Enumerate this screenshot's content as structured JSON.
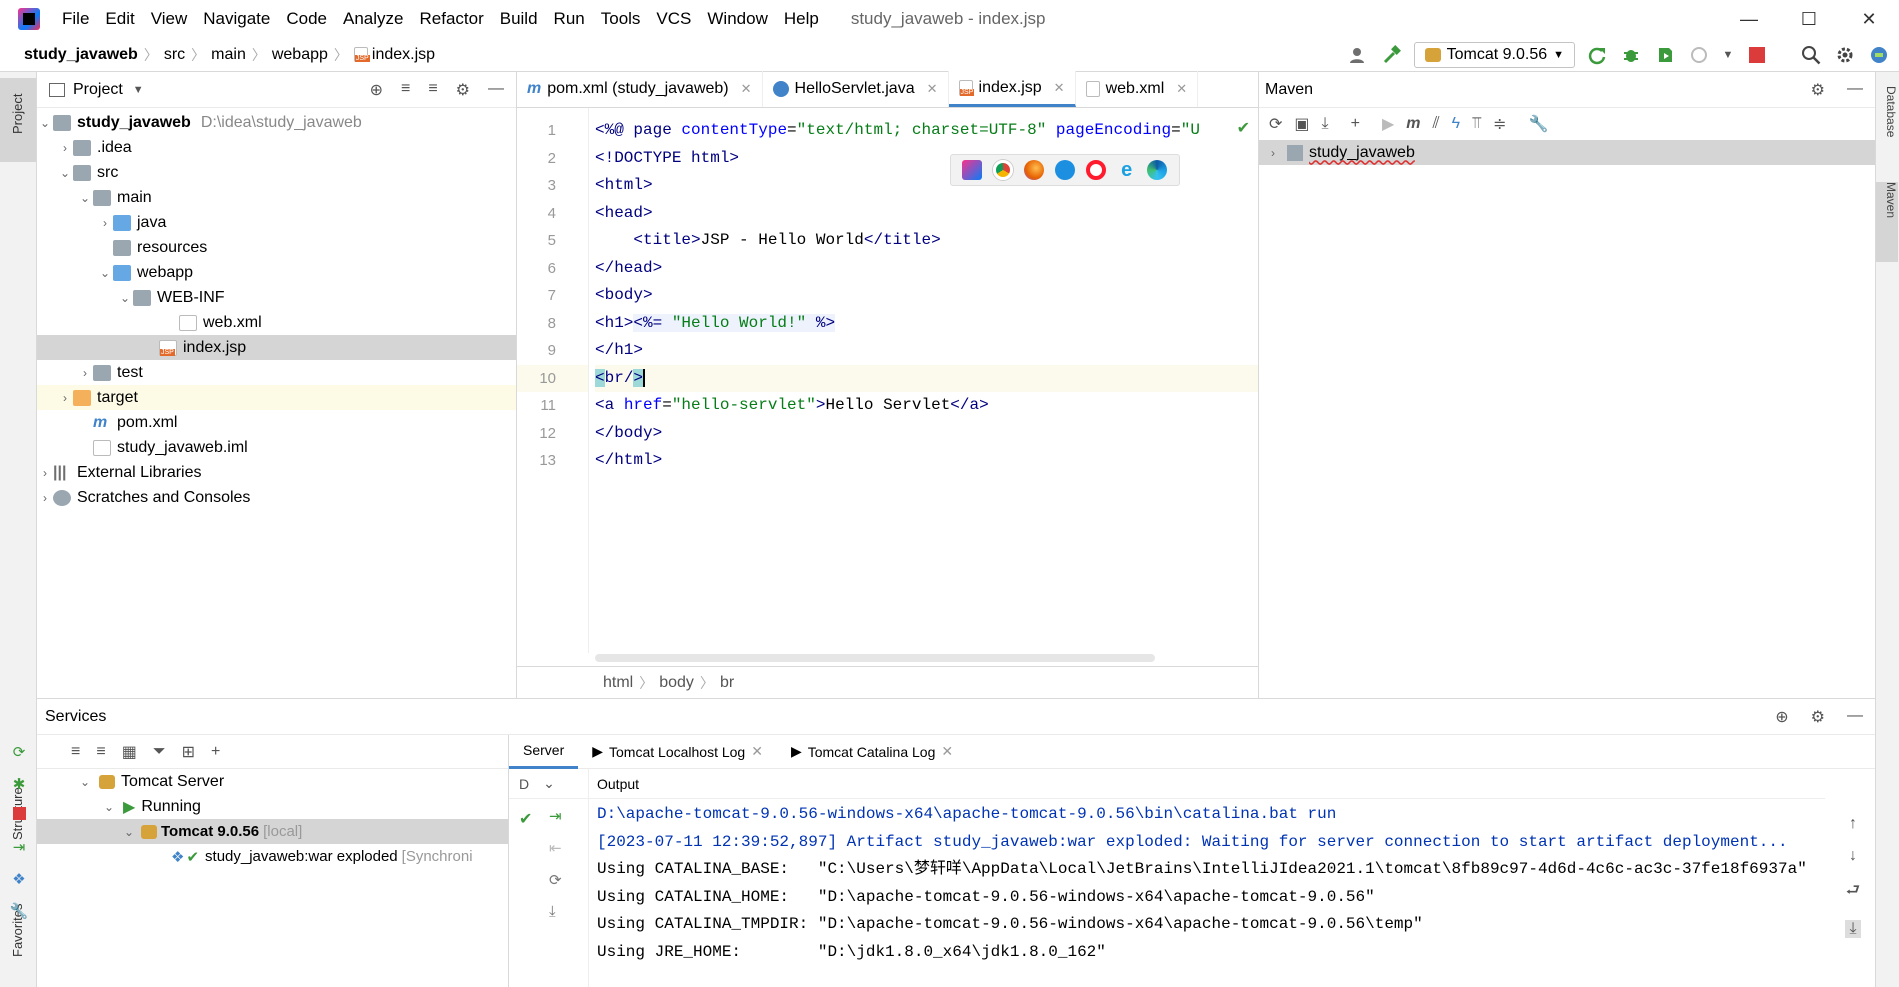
{
  "menu": [
    "File",
    "Edit",
    "View",
    "Navigate",
    "Code",
    "Analyze",
    "Refactor",
    "Build",
    "Run",
    "Tools",
    "VCS",
    "Window",
    "Help"
  ],
  "window_title": "study_javaweb - index.jsp",
  "breadcrumb": [
    "study_javaweb",
    "src",
    "main",
    "webapp",
    "index.jsp"
  ],
  "run_config": "Tomcat 9.0.56",
  "project_panel": {
    "title": "Project",
    "tree": [
      {
        "label": "study_javaweb",
        "path": "D:\\idea\\study_javaweb"
      },
      {
        "label": ".idea"
      },
      {
        "label": "src"
      },
      {
        "label": "main"
      },
      {
        "label": "java"
      },
      {
        "label": "resources"
      },
      {
        "label": "webapp"
      },
      {
        "label": "WEB-INF"
      },
      {
        "label": "web.xml"
      },
      {
        "label": "index.jsp"
      },
      {
        "label": "test"
      },
      {
        "label": "target"
      },
      {
        "label": "pom.xml"
      },
      {
        "label": "study_javaweb.iml"
      },
      {
        "label": "External Libraries"
      },
      {
        "label": "Scratches and Consoles"
      }
    ]
  },
  "editor": {
    "tabs": [
      "pom.xml (study_javaweb)",
      "HelloServlet.java",
      "index.jsp",
      "web.xml"
    ],
    "active_tab": "index.jsp",
    "line_numbers": [
      "1",
      "2",
      "3",
      "4",
      "5",
      "6",
      "7",
      "8",
      "9",
      "10",
      "11",
      "12",
      "13"
    ],
    "breadcrumb": [
      "html",
      "body",
      "br"
    ]
  },
  "maven": {
    "title": "Maven",
    "project": "study_javaweb"
  },
  "services": {
    "title": "Services",
    "tree": {
      "server": "Tomcat Server",
      "state": "Running",
      "instance": "Tomcat 9.0.56",
      "instance_tag": "[local]",
      "artifact": "study_javaweb:war exploded",
      "artifact_status": "[Synchroni"
    },
    "tabs": [
      "Server",
      "Tomcat Localhost Log",
      "Tomcat Catalina Log"
    ],
    "output_label": "Output",
    "output_lines": [
      "D:\\apache-tomcat-9.0.56-windows-x64\\apache-tomcat-9.0.56\\bin\\catalina.bat run",
      "[2023-07-11 12:39:52,897] Artifact study_javaweb:war exploded: Waiting for server connection to start artifact deployment...",
      "Using CATALINA_BASE:   \"C:\\Users\\梦轩咩\\AppData\\Local\\JetBrains\\IntelliJIdea2021.1\\tomcat\\8fb89c97-4d6d-4c6c-ac3c-37fe18f6937a\"",
      "Using CATALINA_HOME:   \"D:\\apache-tomcat-9.0.56-windows-x64\\apache-tomcat-9.0.56\"",
      "Using CATALINA_TMPDIR: \"D:\\apache-tomcat-9.0.56-windows-x64\\apache-tomcat-9.0.56\\temp\"",
      "Using JRE_HOME:        \"D:\\jdk1.8.0_x64\\jdk1.8.0_162\""
    ]
  },
  "side_tabs": {
    "left_top": "Project",
    "left_structure": "Structure",
    "left_favorites": "Favorites",
    "right_database": "Database",
    "right_maven": "Maven"
  },
  "colors": {
    "accent": "#4083c9",
    "selection": "#d5d5d5",
    "run_green": "#3b9a3b",
    "stop_red": "#db3b3b"
  }
}
